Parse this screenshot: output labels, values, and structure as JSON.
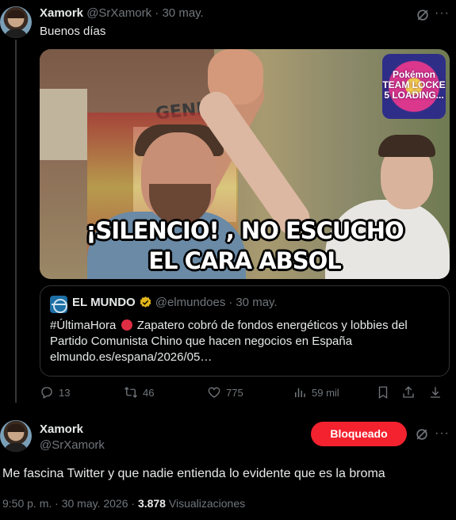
{
  "tweet1": {
    "name": "Xamork",
    "handle": "@SrXamork",
    "separator": "·",
    "date": "30 may.",
    "text": "Buenos días",
    "more": "···",
    "media": {
      "caption_line1": "¡SILENCIO! , NO ESCUCHO",
      "caption_line2": "EL CARA ABSOL",
      "board_text": "GENE",
      "logo_text": "Pokémon TEAM LOCKE 5 LOADING..."
    },
    "quote": {
      "name": "EL MUNDO",
      "handle": "@elmundoes",
      "separator": "·",
      "date": "30 may.",
      "text_before": "#ÚltimaHora",
      "text_after": "Zapatero cobró de fondos energéticos y lobbies del Partido Comunista Chino que hacen negocios en España elmundo.es/espana/2026/05…"
    },
    "actions": {
      "replies": "13",
      "reposts": "46",
      "likes": "775",
      "views": "59 mil"
    }
  },
  "tweet2": {
    "name": "Xamork",
    "handle": "@SrXamork",
    "blocked_label": "Bloqueado",
    "more": "···",
    "text": "Me fascina Twitter y que nadie entienda lo evidente que es la broma",
    "time": "9:50 p. m. · 30 may. 2026 ·",
    "views_count": "3.878",
    "views_label": "Visualizaciones"
  },
  "colors": {
    "background": "#000000",
    "text": "#e7e9ea",
    "muted": "#71767b",
    "border": "#2f3336",
    "blocked": "#f4212e",
    "verified_gold": "#e2b719"
  }
}
